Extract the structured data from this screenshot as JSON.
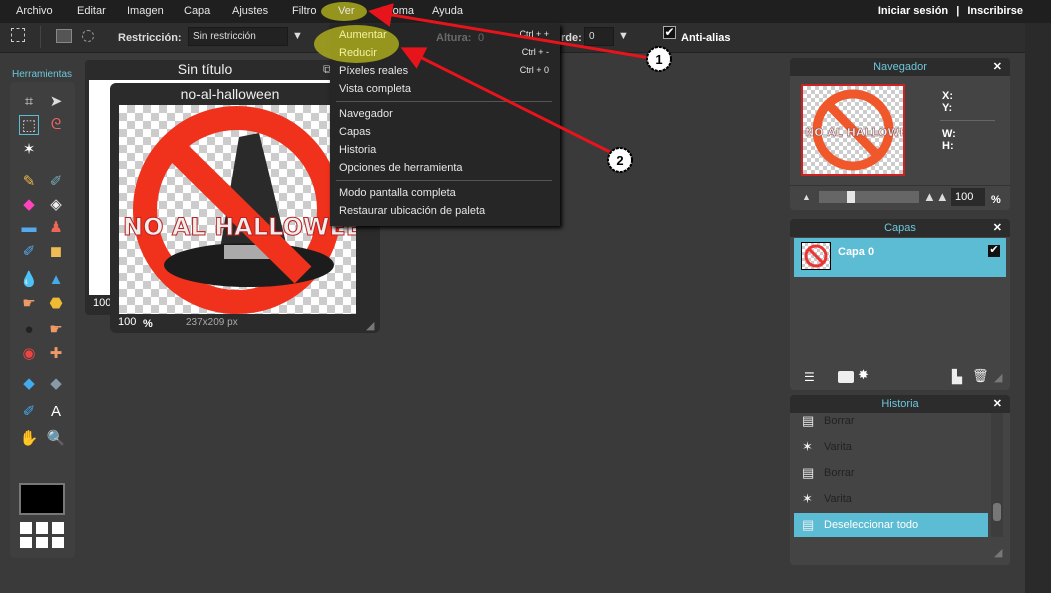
{
  "menubar": {
    "items": [
      "Archivo",
      "Editar",
      "Imagen",
      "Capa",
      "Ajustes",
      "Filtro",
      "Ver",
      "Idioma",
      "Ayuda"
    ],
    "login": "Iniciar sesión",
    "separator": "|",
    "signup": "Inscribirse"
  },
  "toolbar": {
    "restriction_label": "Restricción:",
    "restriction_value": "Sin restricción",
    "height_label": "Altura:",
    "height_value": "0",
    "border_label": "rde:",
    "border_value": "0",
    "antialias_label": "Anti-alias",
    "antialias_checked": true
  },
  "tools": {
    "title": "Herramientas",
    "items": [
      "crop",
      "move",
      "marquee",
      "lasso",
      "magic-wand",
      "pencil",
      "brush",
      "eraser",
      "paint-bucket",
      "gradient",
      "clone-stamp",
      "color-replace",
      "shape",
      "blur",
      "sharpen",
      "smudge",
      "sponge",
      "burn",
      "dodge",
      "red-eye",
      "spot-heal",
      "bloat",
      "pinch",
      "color-picker",
      "type",
      "hand",
      "zoom"
    ],
    "color": "#000000"
  },
  "doc1": {
    "title": "Sin título",
    "zoom": "100"
  },
  "doc2": {
    "title": "no-al-halloween",
    "zoom": "100",
    "zoom_unit": "%",
    "size": "237x209 px",
    "image_text": "NO AL HALLOWEEN"
  },
  "view_menu": {
    "items": [
      {
        "label": "Aumentar",
        "shortcut": "Ctrl + +"
      },
      {
        "label": "Reducir",
        "shortcut": "Ctrl + -"
      },
      {
        "label": "Píxeles reales",
        "shortcut": "Ctrl + 0"
      },
      {
        "label": "Vista completa",
        "shortcut": ""
      },
      {
        "label": "Navegador",
        "shortcut": ""
      },
      {
        "label": "Capas",
        "shortcut": ""
      },
      {
        "label": "Historia",
        "shortcut": ""
      },
      {
        "label": "Opciones de herramienta",
        "shortcut": ""
      },
      {
        "label": "Modo pantalla completa",
        "shortcut": ""
      },
      {
        "label": "Restaurar ubicación de paleta",
        "shortcut": ""
      }
    ]
  },
  "navigator": {
    "title": "Navegador",
    "x_label": "X:",
    "y_label": "Y:",
    "w_label": "W:",
    "h_label": "H:",
    "zoom": "100",
    "zoom_unit": "%",
    "zoom_slider": 0.3
  },
  "layers": {
    "title": "Capas",
    "items": [
      {
        "name": "Capa 0",
        "visible": true
      }
    ]
  },
  "history": {
    "title": "Historia",
    "items": [
      {
        "label": "Borrar",
        "icon": "document-icon"
      },
      {
        "label": "Varita",
        "icon": "wand-icon"
      },
      {
        "label": "Borrar",
        "icon": "document-icon"
      },
      {
        "label": "Varita",
        "icon": "wand-icon"
      },
      {
        "label": "Deseleccionar todo",
        "icon": "document-icon",
        "active": true
      }
    ]
  },
  "annotations": {
    "callout_1": "1",
    "callout_2": "2",
    "arrow_color": "#e8141c",
    "highlight_color": "#a5a51e"
  },
  "colors": {
    "accent": "#5bbcd3",
    "panel_title": "#6cc7dc"
  }
}
